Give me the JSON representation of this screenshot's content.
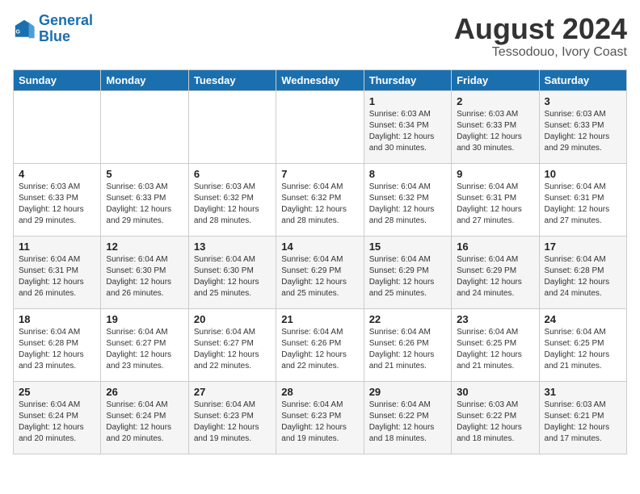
{
  "header": {
    "logo_line1": "General",
    "logo_line2": "Blue",
    "title": "August 2024",
    "subtitle": "Tessodouo, Ivory Coast"
  },
  "days_of_week": [
    "Sunday",
    "Monday",
    "Tuesday",
    "Wednesday",
    "Thursday",
    "Friday",
    "Saturday"
  ],
  "weeks": [
    [
      {
        "day": "",
        "info": ""
      },
      {
        "day": "",
        "info": ""
      },
      {
        "day": "",
        "info": ""
      },
      {
        "day": "",
        "info": ""
      },
      {
        "day": "1",
        "info": "Sunrise: 6:03 AM\nSunset: 6:34 PM\nDaylight: 12 hours\nand 30 minutes."
      },
      {
        "day": "2",
        "info": "Sunrise: 6:03 AM\nSunset: 6:33 PM\nDaylight: 12 hours\nand 30 minutes."
      },
      {
        "day": "3",
        "info": "Sunrise: 6:03 AM\nSunset: 6:33 PM\nDaylight: 12 hours\nand 29 minutes."
      }
    ],
    [
      {
        "day": "4",
        "info": "Sunrise: 6:03 AM\nSunset: 6:33 PM\nDaylight: 12 hours\nand 29 minutes."
      },
      {
        "day": "5",
        "info": "Sunrise: 6:03 AM\nSunset: 6:33 PM\nDaylight: 12 hours\nand 29 minutes."
      },
      {
        "day": "6",
        "info": "Sunrise: 6:03 AM\nSunset: 6:32 PM\nDaylight: 12 hours\nand 28 minutes."
      },
      {
        "day": "7",
        "info": "Sunrise: 6:04 AM\nSunset: 6:32 PM\nDaylight: 12 hours\nand 28 minutes."
      },
      {
        "day": "8",
        "info": "Sunrise: 6:04 AM\nSunset: 6:32 PM\nDaylight: 12 hours\nand 28 minutes."
      },
      {
        "day": "9",
        "info": "Sunrise: 6:04 AM\nSunset: 6:31 PM\nDaylight: 12 hours\nand 27 minutes."
      },
      {
        "day": "10",
        "info": "Sunrise: 6:04 AM\nSunset: 6:31 PM\nDaylight: 12 hours\nand 27 minutes."
      }
    ],
    [
      {
        "day": "11",
        "info": "Sunrise: 6:04 AM\nSunset: 6:31 PM\nDaylight: 12 hours\nand 26 minutes."
      },
      {
        "day": "12",
        "info": "Sunrise: 6:04 AM\nSunset: 6:30 PM\nDaylight: 12 hours\nand 26 minutes."
      },
      {
        "day": "13",
        "info": "Sunrise: 6:04 AM\nSunset: 6:30 PM\nDaylight: 12 hours\nand 25 minutes."
      },
      {
        "day": "14",
        "info": "Sunrise: 6:04 AM\nSunset: 6:29 PM\nDaylight: 12 hours\nand 25 minutes."
      },
      {
        "day": "15",
        "info": "Sunrise: 6:04 AM\nSunset: 6:29 PM\nDaylight: 12 hours\nand 25 minutes."
      },
      {
        "day": "16",
        "info": "Sunrise: 6:04 AM\nSunset: 6:29 PM\nDaylight: 12 hours\nand 24 minutes."
      },
      {
        "day": "17",
        "info": "Sunrise: 6:04 AM\nSunset: 6:28 PM\nDaylight: 12 hours\nand 24 minutes."
      }
    ],
    [
      {
        "day": "18",
        "info": "Sunrise: 6:04 AM\nSunset: 6:28 PM\nDaylight: 12 hours\nand 23 minutes."
      },
      {
        "day": "19",
        "info": "Sunrise: 6:04 AM\nSunset: 6:27 PM\nDaylight: 12 hours\nand 23 minutes."
      },
      {
        "day": "20",
        "info": "Sunrise: 6:04 AM\nSunset: 6:27 PM\nDaylight: 12 hours\nand 22 minutes."
      },
      {
        "day": "21",
        "info": "Sunrise: 6:04 AM\nSunset: 6:26 PM\nDaylight: 12 hours\nand 22 minutes."
      },
      {
        "day": "22",
        "info": "Sunrise: 6:04 AM\nSunset: 6:26 PM\nDaylight: 12 hours\nand 21 minutes."
      },
      {
        "day": "23",
        "info": "Sunrise: 6:04 AM\nSunset: 6:25 PM\nDaylight: 12 hours\nand 21 minutes."
      },
      {
        "day": "24",
        "info": "Sunrise: 6:04 AM\nSunset: 6:25 PM\nDaylight: 12 hours\nand 21 minutes."
      }
    ],
    [
      {
        "day": "25",
        "info": "Sunrise: 6:04 AM\nSunset: 6:24 PM\nDaylight: 12 hours\nand 20 minutes."
      },
      {
        "day": "26",
        "info": "Sunrise: 6:04 AM\nSunset: 6:24 PM\nDaylight: 12 hours\nand 20 minutes."
      },
      {
        "day": "27",
        "info": "Sunrise: 6:04 AM\nSunset: 6:23 PM\nDaylight: 12 hours\nand 19 minutes."
      },
      {
        "day": "28",
        "info": "Sunrise: 6:04 AM\nSunset: 6:23 PM\nDaylight: 12 hours\nand 19 minutes."
      },
      {
        "day": "29",
        "info": "Sunrise: 6:04 AM\nSunset: 6:22 PM\nDaylight: 12 hours\nand 18 minutes."
      },
      {
        "day": "30",
        "info": "Sunrise: 6:03 AM\nSunset: 6:22 PM\nDaylight: 12 hours\nand 18 minutes."
      },
      {
        "day": "31",
        "info": "Sunrise: 6:03 AM\nSunset: 6:21 PM\nDaylight: 12 hours\nand 17 minutes."
      }
    ]
  ]
}
